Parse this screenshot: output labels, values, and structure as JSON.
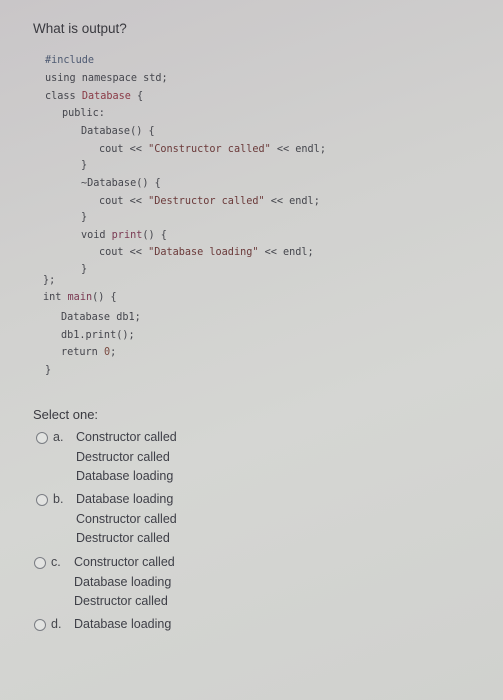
{
  "question": {
    "title": "What is output?",
    "code_lines": [
      {
        "text": "#include",
        "style": "pp"
      },
      {
        "text": "using namespace std;",
        "style": "kw"
      },
      {
        "tokens": [
          {
            "t": "class ",
            "s": "kw"
          },
          {
            "t": "Database",
            "s": "cls"
          },
          {
            "t": " {",
            "s": "kw"
          }
        ]
      },
      {
        "text": "public:",
        "style": "kw"
      },
      {
        "text": "Database() {",
        "style": "kw"
      },
      {
        "tokens": [
          {
            "t": "cout << ",
            "s": "kw"
          },
          {
            "t": "\"Constructor called\"",
            "s": "str"
          },
          {
            "t": " << endl;",
            "s": "kw"
          }
        ]
      },
      {
        "text": "}",
        "style": "kw"
      },
      {
        "text": "~Database() {",
        "style": "kw"
      },
      {
        "tokens": [
          {
            "t": "cout << ",
            "s": "kw"
          },
          {
            "t": "\"Destructor called\"",
            "s": "str"
          },
          {
            "t": " << endl;",
            "s": "kw"
          }
        ]
      },
      {
        "text": "}",
        "style": "kw"
      },
      {
        "tokens": [
          {
            "t": "void ",
            "s": "kw"
          },
          {
            "t": "print",
            "s": "fn"
          },
          {
            "t": "() {",
            "s": "kw"
          }
        ]
      },
      {
        "tokens": [
          {
            "t": "cout << ",
            "s": "kw"
          },
          {
            "t": "\"Database loading\"",
            "s": "str"
          },
          {
            "t": " << endl;",
            "s": "kw"
          }
        ]
      },
      {
        "text": "}",
        "style": "kw"
      },
      {
        "text": "};",
        "style": "kw"
      },
      {
        "tokens": [
          {
            "t": "int ",
            "s": "kw"
          },
          {
            "t": "main",
            "s": "fn"
          },
          {
            "t": "() {",
            "s": "kw"
          }
        ]
      },
      {
        "text": "Database db1;",
        "style": "kw"
      },
      {
        "text": "db1.print();",
        "style": "kw"
      },
      {
        "tokens": [
          {
            "t": "return ",
            "s": "kw"
          },
          {
            "t": "0",
            "s": "num"
          },
          {
            "t": ";",
            "s": "kw"
          }
        ]
      },
      {
        "text": "}",
        "style": "kw"
      }
    ]
  },
  "answer": {
    "select_label": "Select one:",
    "options": [
      {
        "letter": "a.",
        "lines": [
          "Constructor called",
          "Destructor called",
          "Database loading"
        ],
        "selected": false
      },
      {
        "letter": "b.",
        "lines": [
          "Database loading",
          "Constructor called",
          "Destructor called"
        ],
        "selected": false
      },
      {
        "letter": "c.",
        "lines": [
          "Constructor called",
          "Database loading",
          "Destructor called"
        ],
        "selected": false
      },
      {
        "letter": "d.",
        "lines": [
          "Database loading"
        ],
        "selected": false
      }
    ]
  }
}
